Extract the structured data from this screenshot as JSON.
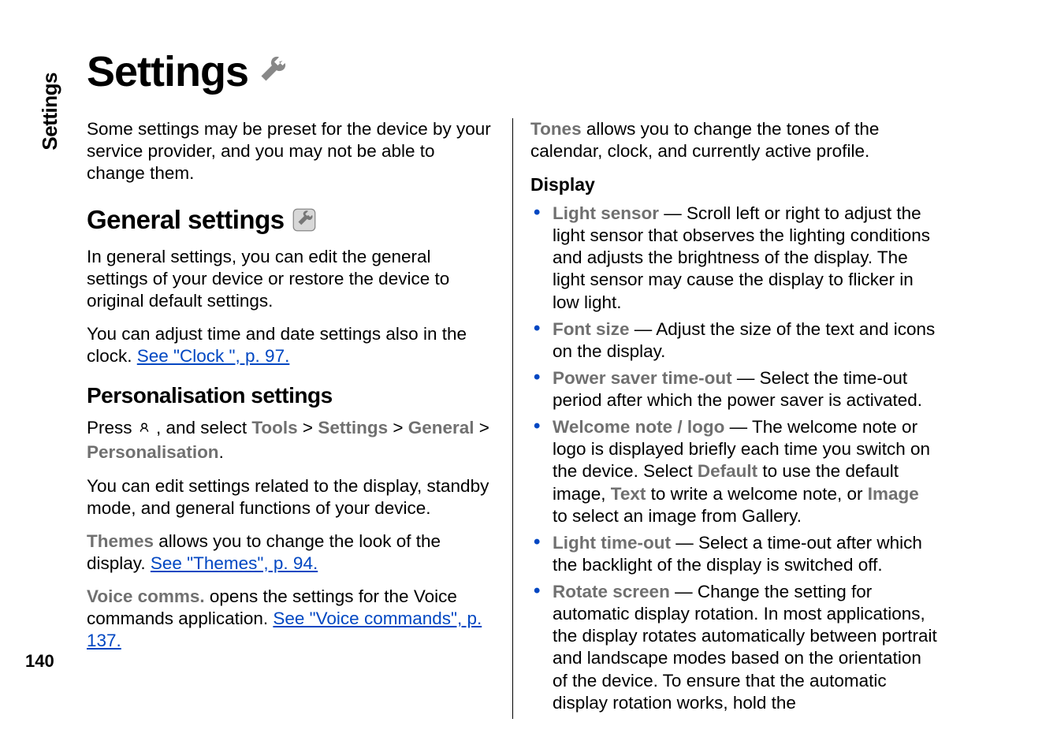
{
  "tab": "Settings",
  "page_number": "140",
  "title": "Settings",
  "intro": "Some settings may be preset for the device by your service provider, and you may not be able to change them.",
  "general": {
    "heading": "General settings",
    "p1": "In general settings, you can edit the general settings of your device or restore the device to original default settings.",
    "p2_prefix": "You can adjust time and date settings also in the clock. ",
    "p2_link": "See \"Clock \", p. 97."
  },
  "personalisation": {
    "heading": "Personalisation settings",
    "nav_prefix": "Press ",
    "nav_mid": " , and select ",
    "nav_tools": "Tools",
    "nav_sep": " > ",
    "nav_settings": "Settings",
    "nav_general": "General",
    "nav_personalisation": "Personalisation",
    "nav_period": ".",
    "p2": "You can edit settings related to the display, standby mode, and general functions of your device.",
    "themes_term": "Themes",
    "themes_rest": " allows you to change the look of the display. ",
    "themes_link": "See \"Themes\", p. 94.",
    "voice_term": "Voice comms.",
    "voice_rest": " opens the settings for the Voice commands application. ",
    "voice_link": "See \"Voice commands\", p. 137."
  },
  "right": {
    "tones_term": "Tones",
    "tones_rest": " allows you to change the tones of the calendar, clock, and currently active profile.",
    "display_heading": "Display",
    "items": [
      {
        "term": "Light sensor",
        "rest": " — Scroll left or right to adjust the light sensor that observes the lighting conditions and adjusts the brightness of the display. The light sensor may cause the display to flicker in low light."
      },
      {
        "term": "Font size",
        "rest": " — Adjust the size of the text and icons on the display."
      },
      {
        "term": "Power saver time-out",
        "rest": " — Select the time-out period after which the power saver is activated."
      },
      {
        "term": "Welcome note / logo",
        "rest_prefix": " — The welcome note or logo is displayed briefly each time you switch on the device. Select ",
        "opt1": "Default",
        "mid1": " to use the default image, ",
        "opt2": "Text",
        "mid2": " to write a welcome note, or ",
        "opt3": "Image",
        "mid3": " to select an image from Gallery."
      },
      {
        "term": "Light time-out",
        "rest": " — Select a time-out after which the backlight of the display is switched off."
      },
      {
        "term": "Rotate screen",
        "rest": " — Change the setting for automatic display rotation. In most applications, the display rotates automatically between portrait and landscape modes based on the orientation of the device. To ensure that the automatic display rotation works, hold the"
      }
    ]
  }
}
